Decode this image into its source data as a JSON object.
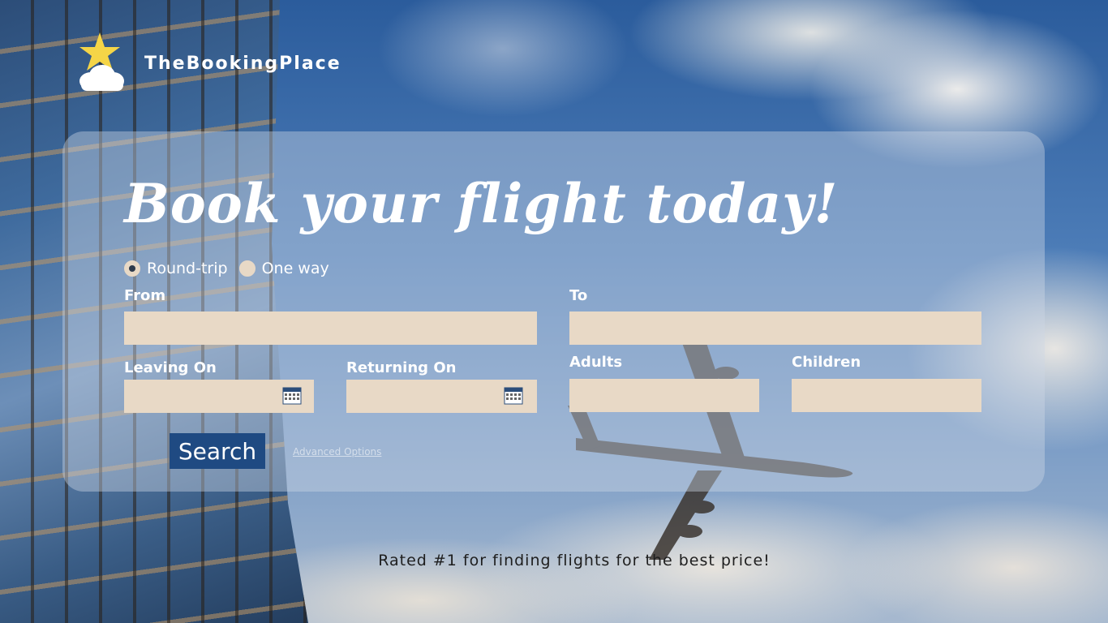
{
  "brand": {
    "name": "TheBookingPlace"
  },
  "hero": {
    "title": "Book your flight today!"
  },
  "trip_type": {
    "options": [
      {
        "label": "Round-trip",
        "selected": true
      },
      {
        "label": "One way",
        "selected": false
      }
    ]
  },
  "form": {
    "from_label": "From",
    "to_label": "To",
    "from_value": "",
    "to_value": "",
    "leaving_label": "Leaving On",
    "returning_label": "Returning On",
    "adults_label": "Adults",
    "children_label": "Children",
    "search_label": "Search",
    "advanced_label": "Advanced Options"
  },
  "footer": {
    "tagline": "Rated #1 for finding flights for the best price!"
  },
  "colors": {
    "input_bg": "#e8d9c6",
    "button_bg": "#1f4a82",
    "text": "#ffffff",
    "star": "#f5d547"
  }
}
